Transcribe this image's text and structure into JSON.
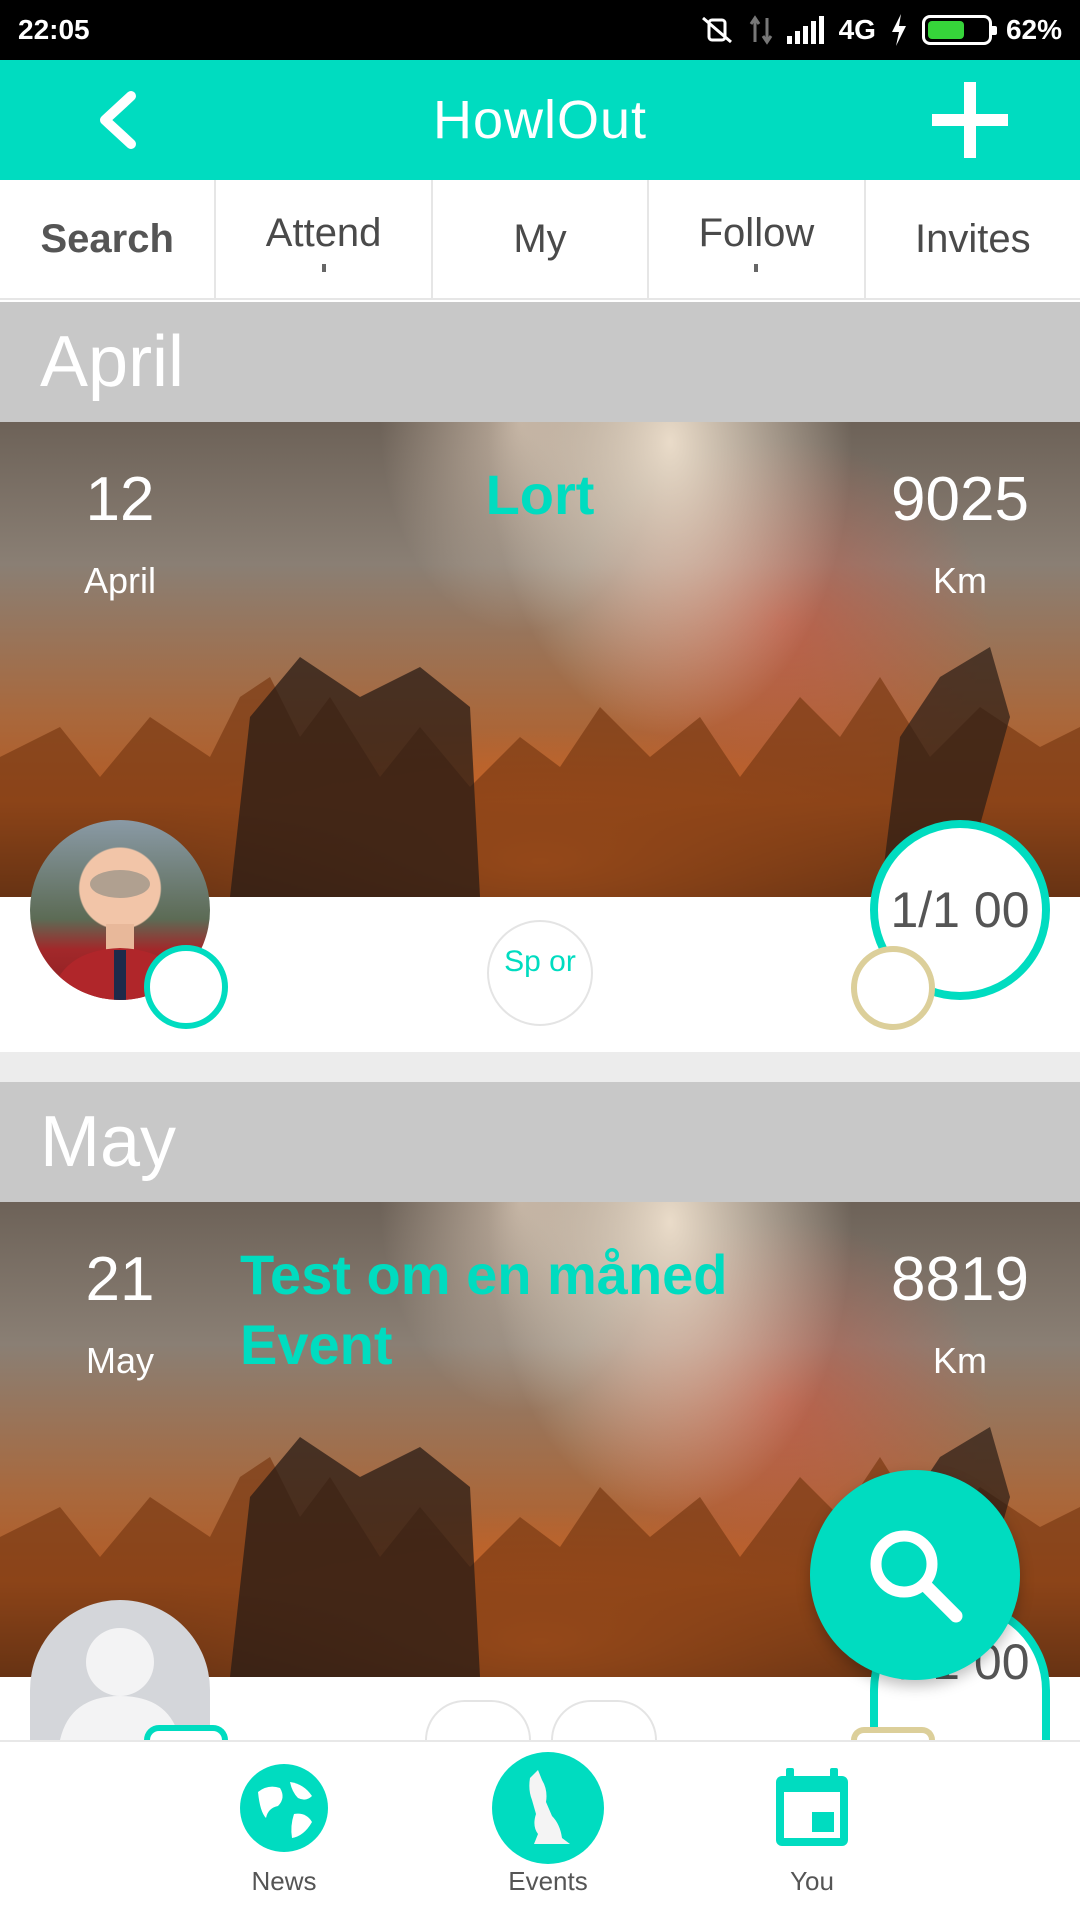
{
  "status_bar": {
    "time": "22:05",
    "network": "4G",
    "battery": "62%",
    "battery_level": 0.62
  },
  "app_bar": {
    "title": "HowlOut",
    "back_icon": "chevron-left-icon",
    "add_icon": "plus-icon"
  },
  "tabs": [
    {
      "label": "Search",
      "active": true
    },
    {
      "label": "Attend",
      "active": false
    },
    {
      "label": "My",
      "active": false
    },
    {
      "label": "Follow",
      "active": false
    },
    {
      "label": "Invites",
      "active": false
    }
  ],
  "sections": [
    {
      "month": "April",
      "event": {
        "day": "12",
        "month": "April",
        "title": "Lort",
        "distance": "9025",
        "distance_unit": "Km",
        "sport_chip": "Sp or",
        "capacity": "1/1 00"
      }
    },
    {
      "month": "May",
      "event": {
        "day": "21",
        "month": "May",
        "title": "Test om en måned Event",
        "distance": "8819",
        "distance_unit": "Km",
        "capacity": "0/1 00"
      }
    }
  ],
  "fab": {
    "icon": "search-icon"
  },
  "bottom_nav": [
    {
      "label": "News",
      "icon": "globe-icon"
    },
    {
      "label": "Events",
      "icon": "wolf-icon"
    },
    {
      "label": "You",
      "icon": "calendar-icon"
    }
  ],
  "colors": {
    "accent": "#00dcc0",
    "month_header": "#c8c8c8",
    "ring_gold": "#dccf9a"
  }
}
